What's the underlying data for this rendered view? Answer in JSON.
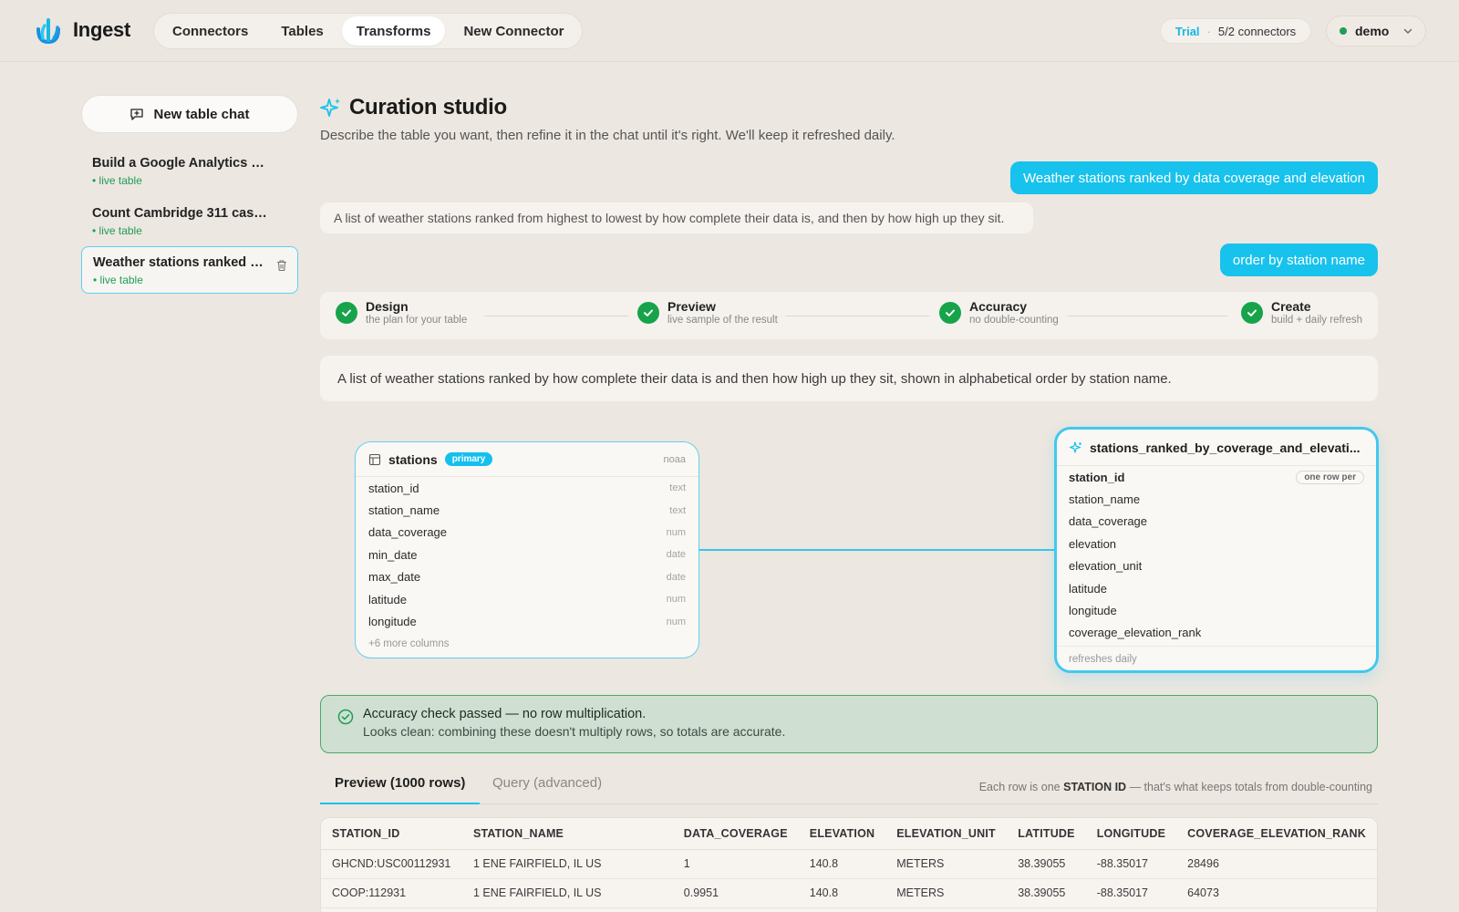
{
  "app": {
    "name": "Ingest"
  },
  "nav": [
    {
      "label": "Connectors",
      "active": false
    },
    {
      "label": "Tables",
      "active": false
    },
    {
      "label": "Transforms",
      "active": true
    },
    {
      "label": "New Connector",
      "active": false
    }
  ],
  "plan": {
    "badge": "Trial",
    "separator": "·",
    "usage": "5/2 connectors"
  },
  "user": {
    "name": "demo",
    "status_color": "#1f9d55"
  },
  "sidebar": {
    "new_chat_label": "New table chat",
    "items": [
      {
        "title": "Build a Google Analytics T...",
        "status": "• live table"
      },
      {
        "title": "Count Cambridge 311 case...",
        "status": "• live table"
      },
      {
        "title": "Weather stations ranked b...",
        "status": "• live table",
        "active": true
      }
    ]
  },
  "main": {
    "title": "Curation studio",
    "subtitle": "Describe the table you want, then refine it in the chat until it's right. We'll keep it refreshed daily."
  },
  "chat": {
    "user_1": "Weather stations ranked by data coverage and elevation",
    "bot_1": "A list of weather stations ranked from highest to lowest by how complete their data is, and then by how high up they sit.",
    "user_2": "order by station name"
  },
  "steps": [
    {
      "title": "Design",
      "subtitle": "the plan for your table",
      "done": true
    },
    {
      "title": "Preview",
      "subtitle": "live sample of the result",
      "done": true
    },
    {
      "title": "Accuracy",
      "subtitle": "no double-counting",
      "done": true
    },
    {
      "title": "Create",
      "subtitle": "build + daily refresh",
      "done": true
    }
  ],
  "summary": "A list of weather stations ranked by how complete their data is and then how high up they sit, shown in alphabetical order by station name.",
  "source_table": {
    "name": "stations",
    "badge": "primary",
    "source": "noaa",
    "columns": [
      {
        "name": "station_id",
        "type": "text"
      },
      {
        "name": "station_name",
        "type": "text"
      },
      {
        "name": "data_coverage",
        "type": "num"
      },
      {
        "name": "min_date",
        "type": "date"
      },
      {
        "name": "max_date",
        "type": "date"
      },
      {
        "name": "latitude",
        "type": "num"
      },
      {
        "name": "longitude",
        "type": "num"
      }
    ],
    "more": "+6 more columns"
  },
  "output_table": {
    "name": "stations_ranked_by_coverage_and_elevati...",
    "grain_badge": "one row per",
    "columns": [
      "station_id",
      "station_name",
      "data_coverage",
      "elevation",
      "elevation_unit",
      "latitude",
      "longitude",
      "coverage_elevation_rank"
    ],
    "footer": "refreshes daily"
  },
  "accuracy": {
    "title": "Accuracy check passed — no row multiplication.",
    "detail": "Looks clean: combining these doesn't multiply rows, so totals are accurate."
  },
  "tabs": {
    "preview": "Preview (1000 rows)",
    "query": "Query (advanced)",
    "note_prefix": "Each row is one ",
    "note_key": "STATION ID",
    "note_suffix": " — that's what keeps totals from double-counting"
  },
  "table": {
    "headers": [
      "STATION_ID",
      "STATION_NAME",
      "DATA_COVERAGE",
      "ELEVATION",
      "ELEVATION_UNIT",
      "LATITUDE",
      "LONGITUDE",
      "COVERAGE_ELEVATION_RANK"
    ],
    "rows": [
      [
        "GHCND:USC00112931",
        "1 ENE FAIRFIELD, IL US",
        "1",
        "140.8",
        "METERS",
        "38.39055",
        "-88.35017",
        "28496"
      ],
      [
        "COOP:112931",
        "1 ENE FAIRFIELD, IL US",
        "0.9951",
        "140.8",
        "METERS",
        "38.39055",
        "-88.35017",
        "64073"
      ],
      [
        "",
        "",
        "",
        "",
        "",
        "",
        "",
        ""
      ]
    ]
  },
  "colors": {
    "accent": "#17c2ec",
    "success": "#17a34a",
    "success_bg": "#cfe0d3"
  }
}
